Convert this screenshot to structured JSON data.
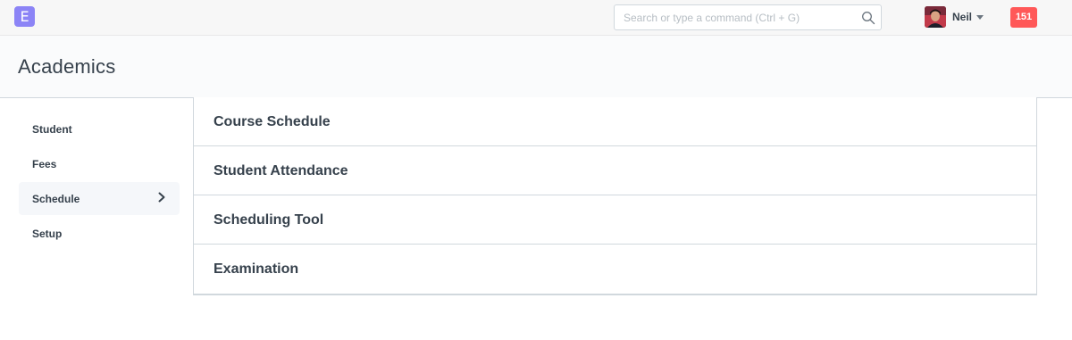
{
  "navbar": {
    "logo_letter": "E",
    "search_placeholder": "Search or type a command (Ctrl + G)",
    "user_name": "Neil",
    "notification_count": "151"
  },
  "page": {
    "title": "Academics"
  },
  "sidebar": {
    "items": [
      {
        "label": "Student"
      },
      {
        "label": "Fees"
      },
      {
        "label": "Schedule"
      },
      {
        "label": "Setup"
      }
    ],
    "active_index": 2
  },
  "modules": [
    {
      "label": "Course Schedule"
    },
    {
      "label": "Student Attendance"
    },
    {
      "label": "Scheduling Tool"
    },
    {
      "label": "Examination"
    }
  ],
  "colors": {
    "logo": "#8c84f6",
    "badge": "#ff5858",
    "text": "#36414c"
  }
}
